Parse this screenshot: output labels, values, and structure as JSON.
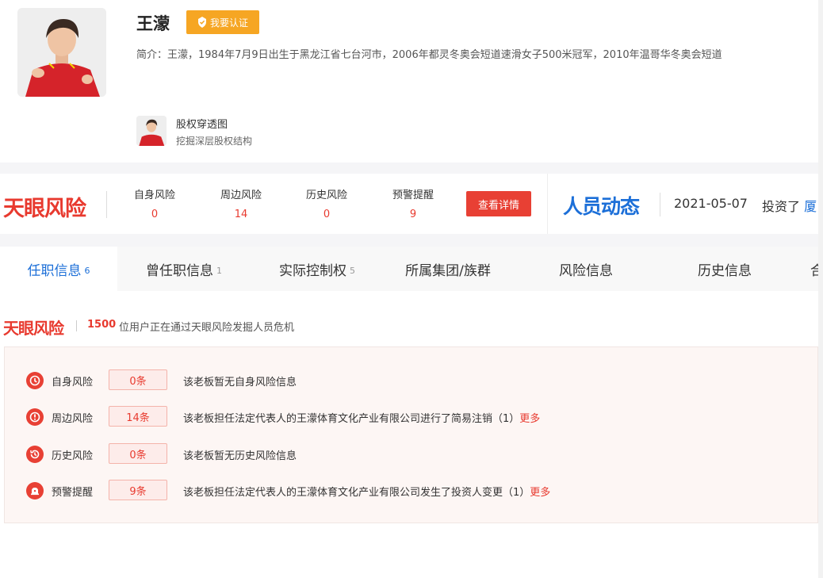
{
  "profile": {
    "name": "王濛",
    "cert_label": "我要认证",
    "bio": "简介：王濛，1984年7月9日出生于黑龙江省七台河市，2006年都灵冬奥会短道速滑女子500米冠军，2010年温哥华冬奥会短道",
    "equity_title": "股权穿透图",
    "equity_sub": "挖掘深层股权结构"
  },
  "risk_band": {
    "logo": "天眼风险",
    "stats": [
      {
        "label": "自身风险",
        "value": "0"
      },
      {
        "label": "周边风险",
        "value": "14"
      },
      {
        "label": "历史风险",
        "value": "0"
      },
      {
        "label": "预警提醒",
        "value": "9"
      }
    ],
    "detail_button": "查看详情"
  },
  "dynamics": {
    "title": "人员动态",
    "date": "2021-05-07",
    "action": "投资了",
    "link": "厦"
  },
  "tabs": [
    {
      "label": "任职信息",
      "count": "6"
    },
    {
      "label": "曾任职信息",
      "count": "1"
    },
    {
      "label": "实际控制权",
      "count": "5"
    },
    {
      "label": "所属集团/族群",
      "count": ""
    },
    {
      "label": "风险信息",
      "count": ""
    },
    {
      "label": "历史信息",
      "count": ""
    },
    {
      "label": "合",
      "count": ""
    }
  ],
  "risk_section": {
    "logo": "天眼风险",
    "user_count": "1500",
    "text": "位用户正在通过天眼风险发掘人员危机",
    "rows": [
      {
        "icon": "clock-alert-icon",
        "label": "自身风险",
        "badge": "0条",
        "text": "该老板暂无自身风险信息",
        "more": ""
      },
      {
        "icon": "target-alert-icon",
        "label": "周边风险",
        "badge": "14条",
        "text": "该老板担任法定代表人的王濛体育文化产业有限公司进行了简易注销（1）",
        "more": "更多"
      },
      {
        "icon": "history-icon",
        "label": "历史风险",
        "badge": "0条",
        "text": "该老板暂无历史风险信息",
        "more": ""
      },
      {
        "icon": "alarm-bell-icon",
        "label": "预警提醒",
        "badge": "9条",
        "text": "该老板担任法定代表人的王濛体育文化产业有限公司发生了投资人变更（1）",
        "more": "更多"
      }
    ]
  },
  "colors": {
    "brand_red": "#e83a2f",
    "brand_blue": "#1c6fd8",
    "cert_orange": "#f6a623"
  }
}
